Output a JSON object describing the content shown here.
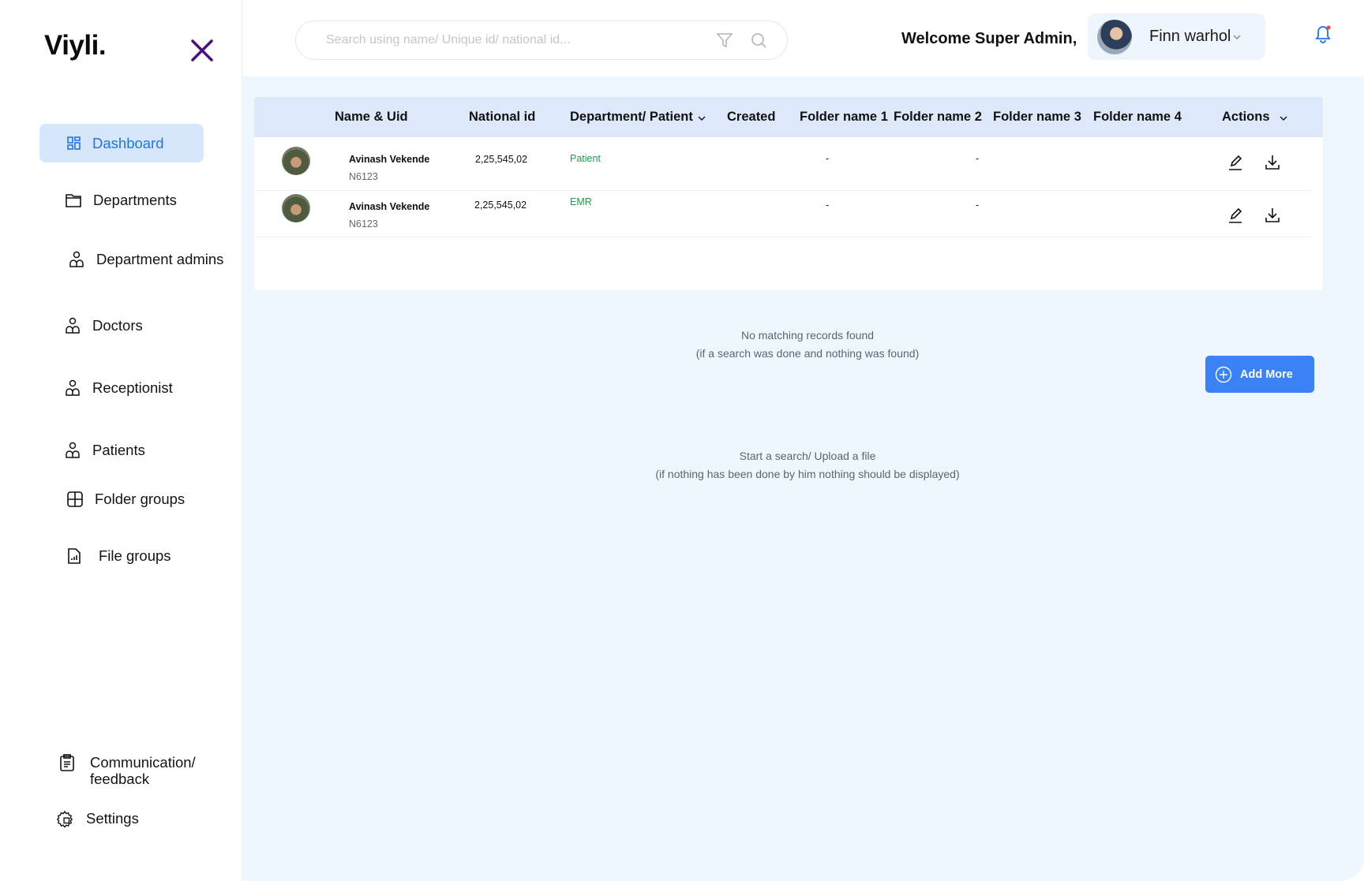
{
  "logo": "Viyli.",
  "sidebar": {
    "items": [
      {
        "label": "Dashboard",
        "icon": "dashboard-icon",
        "active": true
      },
      {
        "label": "Departments",
        "icon": "folder-icon"
      },
      {
        "label": "Department admins",
        "icon": "users-icon"
      },
      {
        "label": "Doctors",
        "icon": "users-icon"
      },
      {
        "label": "Receptionist",
        "icon": "users-icon"
      },
      {
        "label": "Patients",
        "icon": "users-icon"
      },
      {
        "label": "Folder groups",
        "icon": "grid-icon"
      },
      {
        "label": "File groups",
        "icon": "file-chart-icon"
      },
      {
        "label": "Communication/",
        "label2": "feedback",
        "icon": "clipboard-icon"
      },
      {
        "label": "Settings",
        "icon": "gear-icon"
      }
    ]
  },
  "header": {
    "search_placeholder": "Search using name/ Unique id/ national id...",
    "welcome": "Welcome Super Admin,",
    "user_name": "Finn warhol"
  },
  "table": {
    "columns": [
      "Name & Uid",
      "National id",
      "Department/ Patient",
      "Created",
      "Folder name 1",
      "Folder name 2",
      "Folder name 3",
      "Folder name 4",
      "Actions"
    ],
    "rows": [
      {
        "name": "Avinash Vekende",
        "uid": "N6123",
        "national_id": "2,25,545,02",
        "department": "Patient",
        "folder1": "-",
        "folder2": "-"
      },
      {
        "name": "Avinash Vekende",
        "uid": "N6123",
        "national_id": "2,25,545,02",
        "department": "EMR",
        "folder1": "-",
        "folder2": "-"
      }
    ]
  },
  "empty": {
    "no_match": "No matching records found",
    "no_match_hint": "(if a search was done and nothing was found)",
    "start": "Start a search/ Upload a file",
    "start_hint": "(if nothing has been done by him nothing should be displayed)"
  },
  "add_more": "Add More",
  "colors": {
    "accent": "#3b82f6",
    "active_bg": "#d6e6fb",
    "close": "#4b0f80",
    "dept": "#1f9d4a"
  }
}
